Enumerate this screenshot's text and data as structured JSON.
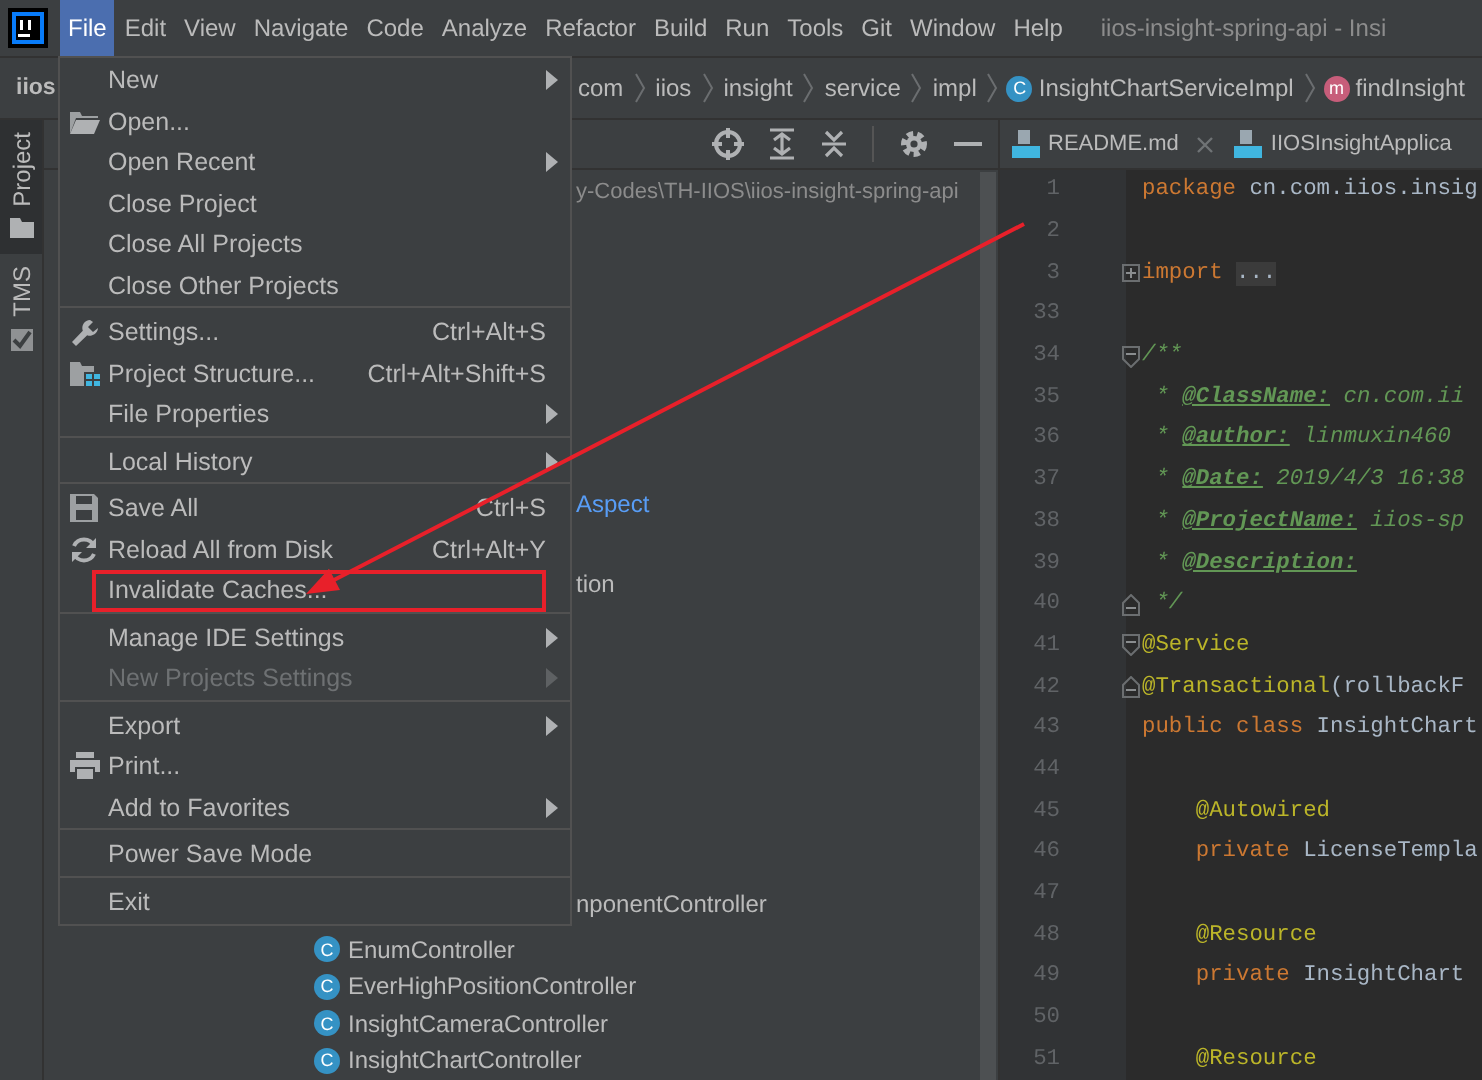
{
  "menu_bar": {
    "items": [
      {
        "label": "File",
        "selected": true
      },
      {
        "label": "Edit",
        "selected": false
      },
      {
        "label": "View",
        "selected": false
      },
      {
        "label": "Navigate",
        "selected": false
      },
      {
        "label": "Code",
        "selected": false
      },
      {
        "label": "Analyze",
        "selected": false
      },
      {
        "label": "Refactor",
        "selected": false
      },
      {
        "label": "Build",
        "selected": false
      },
      {
        "label": "Run",
        "selected": false
      },
      {
        "label": "Tools",
        "selected": false
      },
      {
        "label": "Git",
        "selected": false
      },
      {
        "label": "Window",
        "selected": false
      },
      {
        "label": "Help",
        "selected": false
      }
    ],
    "title": "iios-insight-spring-api - Insi"
  },
  "nav_bar": {
    "project": "iios",
    "crumbs": [
      {
        "label": "com",
        "kind": "package"
      },
      {
        "label": "iios",
        "kind": "package"
      },
      {
        "label": "insight",
        "kind": "package"
      },
      {
        "label": "service",
        "kind": "package"
      },
      {
        "label": "impl",
        "kind": "package"
      },
      {
        "label": "InsightChartServiceImpl",
        "kind": "class",
        "badge": "C"
      },
      {
        "label": "findInsight",
        "kind": "method",
        "badge": "m"
      }
    ]
  },
  "tool_stripe": {
    "tabs": [
      {
        "label": "Project",
        "selected": true
      },
      {
        "label": "TMS",
        "selected": false
      }
    ]
  },
  "project_panel": {
    "path": "y-Codes\\TH-IIOS\\iios-insight-spring-api",
    "rows": [
      {
        "text": "Aspect",
        "kind": "accent"
      },
      {
        "text": "tion",
        "kind": "fragment"
      },
      {
        "text": "nponentController",
        "kind": "fragment"
      },
      {
        "text": "EnumController",
        "kind": "class",
        "badge": "C"
      },
      {
        "text": "EverHighPositionController",
        "kind": "class",
        "badge": "C"
      },
      {
        "text": "InsightCameraController",
        "kind": "class",
        "badge": "C"
      },
      {
        "text": "InsightChartController",
        "kind": "class",
        "badge": "C"
      }
    ]
  },
  "editor": {
    "tabs": [
      {
        "label": "README.md",
        "selected": false,
        "closable": true
      },
      {
        "label": "IIOSInsightApplica",
        "selected": false,
        "closable": false
      }
    ],
    "lines": [
      {
        "number": "1",
        "tokens": [
          {
            "t": "package ",
            "kind": "keyword"
          },
          {
            "t": "cn.com.iios.insig",
            "kind": "plain"
          }
        ]
      },
      {
        "number": "2"
      },
      {
        "number": "3",
        "fold": {
          "kind": "expand"
        },
        "tokens": [
          {
            "t": "import ",
            "kind": "keyword"
          },
          {
            "t": "...",
            "kind": "folded"
          }
        ]
      },
      {
        "number": "33"
      },
      {
        "number": "34",
        "fold": {
          "kind": "start"
        },
        "tokens": [
          {
            "t": "/**",
            "kind": "doc"
          }
        ]
      },
      {
        "number": "35",
        "tokens": [
          {
            "t": " * ",
            "kind": "doc"
          },
          {
            "t": "@ClassName:",
            "kind": "doctag"
          },
          {
            "t": " cn.com.ii",
            "kind": "doc"
          }
        ]
      },
      {
        "number": "36",
        "tokens": [
          {
            "t": " * ",
            "kind": "doc"
          },
          {
            "t": "@author:",
            "kind": "doctag"
          },
          {
            "t": " linmuxin460",
            "kind": "doc"
          }
        ]
      },
      {
        "number": "37",
        "tokens": [
          {
            "t": " * ",
            "kind": "doc"
          },
          {
            "t": "@Date:",
            "kind": "doctag"
          },
          {
            "t": " 2019/4/3 16:38",
            "kind": "doc"
          }
        ]
      },
      {
        "number": "38",
        "tokens": [
          {
            "t": " * ",
            "kind": "doc"
          },
          {
            "t": "@ProjectName:",
            "kind": "doctag"
          },
          {
            "t": " iios-sp",
            "kind": "doc"
          }
        ]
      },
      {
        "number": "39",
        "tokens": [
          {
            "t": " * ",
            "kind": "doc"
          },
          {
            "t": "@Description:",
            "kind": "doctag"
          }
        ]
      },
      {
        "number": "40",
        "fold": {
          "kind": "end"
        },
        "tokens": [
          {
            "t": " */",
            "kind": "doc"
          }
        ]
      },
      {
        "number": "41",
        "fold": {
          "kind": "start"
        },
        "tokens": [
          {
            "t": "@Service",
            "kind": "annotation"
          }
        ]
      },
      {
        "number": "42",
        "fold": {
          "kind": "end"
        },
        "tokens": [
          {
            "t": "@Transactional",
            "kind": "annotation"
          },
          {
            "t": "(rollbackF",
            "kind": "plain"
          }
        ]
      },
      {
        "number": "43",
        "tokens": [
          {
            "t": "public class ",
            "kind": "keyword"
          },
          {
            "t": "InsightChart",
            "kind": "plain"
          }
        ]
      },
      {
        "number": "44"
      },
      {
        "number": "45",
        "tokens": [
          {
            "t": "    @Autowired",
            "kind": "annotation"
          }
        ]
      },
      {
        "number": "46",
        "tokens": [
          {
            "t": "    private ",
            "kind": "keyword"
          },
          {
            "t": "LicenseTempla",
            "kind": "plain"
          }
        ]
      },
      {
        "number": "47"
      },
      {
        "number": "48",
        "tokens": [
          {
            "t": "    @Resource",
            "kind": "annotation"
          }
        ]
      },
      {
        "number": "49",
        "tokens": [
          {
            "t": "    private ",
            "kind": "keyword"
          },
          {
            "t": "InsightChart",
            "kind": "plain"
          }
        ]
      },
      {
        "number": "50"
      },
      {
        "number": "51",
        "tokens": [
          {
            "t": "    @Resource",
            "kind": "annotation"
          }
        ]
      }
    ]
  },
  "file_menu": {
    "groups": [
      [
        {
          "label": "New",
          "submenu": true,
          "disabled": false,
          "boxed": false
        },
        {
          "label": "Open...",
          "submenu": false,
          "disabled": false,
          "boxed": false
        },
        {
          "label": "Open Recent",
          "submenu": true,
          "disabled": false,
          "boxed": false
        },
        {
          "label": "Close Project",
          "submenu": false,
          "disabled": false,
          "boxed": false
        },
        {
          "label": "Close All Projects",
          "submenu": false,
          "disabled": false,
          "boxed": false
        },
        {
          "label": "Close Other Projects",
          "submenu": false,
          "disabled": false,
          "boxed": false
        }
      ],
      [
        {
          "label": "Settings...",
          "shortcut": "Ctrl+Alt+S",
          "submenu": false,
          "disabled": false,
          "boxed": false
        },
        {
          "label": "Project Structure...",
          "shortcut": "Ctrl+Alt+Shift+S",
          "submenu": false,
          "disabled": false,
          "boxed": false
        },
        {
          "label": "File Properties",
          "submenu": true,
          "disabled": false,
          "boxed": false
        }
      ],
      [
        {
          "label": "Local History",
          "submenu": true,
          "disabled": false,
          "boxed": false
        }
      ],
      [
        {
          "label": "Save All",
          "shortcut": "Ctrl+S",
          "submenu": false,
          "disabled": false,
          "boxed": false
        },
        {
          "label": "Reload All from Disk",
          "shortcut": "Ctrl+Alt+Y",
          "submenu": false,
          "disabled": false,
          "boxed": false
        },
        {
          "label": "Invalidate Caches...",
          "submenu": false,
          "disabled": false,
          "boxed": true
        }
      ],
      [
        {
          "label": "Manage IDE Settings",
          "submenu": true,
          "disabled": false,
          "boxed": false
        },
        {
          "label": "New Projects Settings",
          "submenu": true,
          "disabled": true,
          "boxed": false
        }
      ],
      [
        {
          "label": "Export",
          "submenu": true,
          "disabled": false,
          "boxed": false
        },
        {
          "label": "Print...",
          "submenu": false,
          "disabled": false,
          "boxed": false
        },
        {
          "label": "Add to Favorites",
          "submenu": true,
          "disabled": false,
          "boxed": false
        }
      ],
      [
        {
          "label": "Power Save Mode",
          "submenu": false,
          "disabled": false,
          "boxed": false
        }
      ],
      [
        {
          "label": "Exit",
          "submenu": false,
          "disabled": false,
          "boxed": false
        }
      ]
    ]
  }
}
